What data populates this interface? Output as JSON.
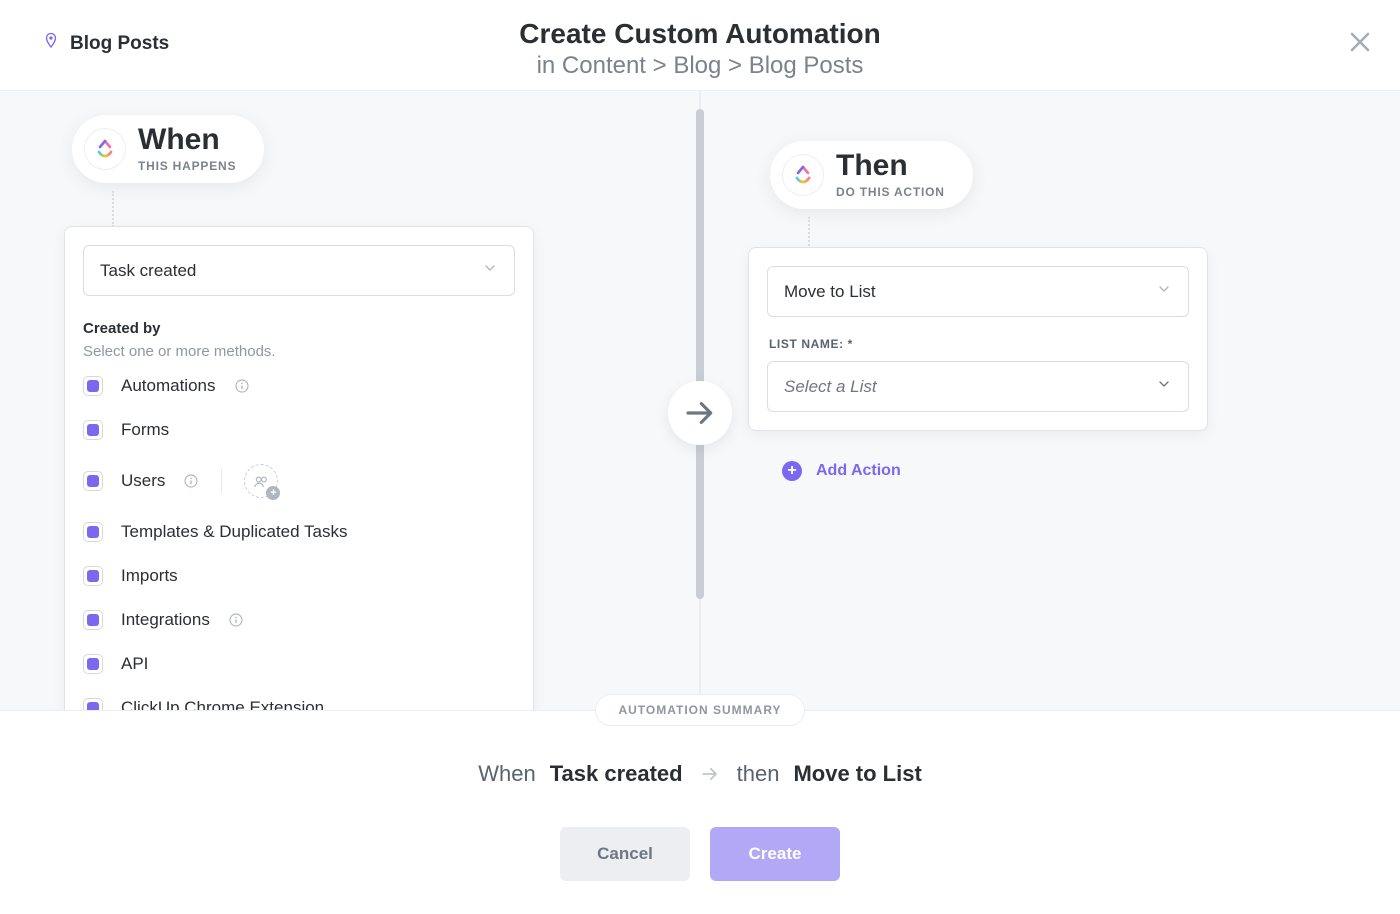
{
  "location": "Blog Posts",
  "title": {
    "main": "Create Custom Automation",
    "sub": "in Content > Blog > Blog Posts"
  },
  "when": {
    "label": "When",
    "sub": "THIS HAPPENS",
    "trigger": "Task created",
    "created_by": {
      "heading": "Created by",
      "hint": "Select one or more methods.",
      "options": [
        {
          "label": "Automations",
          "checked": true,
          "info": true
        },
        {
          "label": "Forms",
          "checked": true
        },
        {
          "label": "Users",
          "checked": true,
          "info": true,
          "users": true
        },
        {
          "label": "Templates & Duplicated Tasks",
          "checked": true
        },
        {
          "label": "Imports",
          "checked": true
        },
        {
          "label": "Integrations",
          "checked": true,
          "info": true
        },
        {
          "label": "API",
          "checked": true
        },
        {
          "label": "ClickUp Chrome Extension",
          "checked": true
        }
      ]
    }
  },
  "then": {
    "label": "Then",
    "sub": "DO THIS ACTION",
    "action": "Move to List",
    "list_field_label": "LIST NAME: *",
    "list_placeholder": "Select a List",
    "add_action": "Add Action"
  },
  "summary": {
    "pill": "AUTOMATION SUMMARY",
    "when_prefix": "When",
    "when_bold": "Task created",
    "then_prefix": "then",
    "then_bold": "Move to List"
  },
  "buttons": {
    "cancel": "Cancel",
    "create": "Create"
  },
  "icons": {
    "pin": "pin-icon",
    "close": "close-icon",
    "chevron": "chevron-down-icon",
    "logo": "app-logo-icon",
    "arrow": "arrow-right-icon",
    "info": "info-icon",
    "users": "users-icon",
    "plus": "plus-icon"
  }
}
